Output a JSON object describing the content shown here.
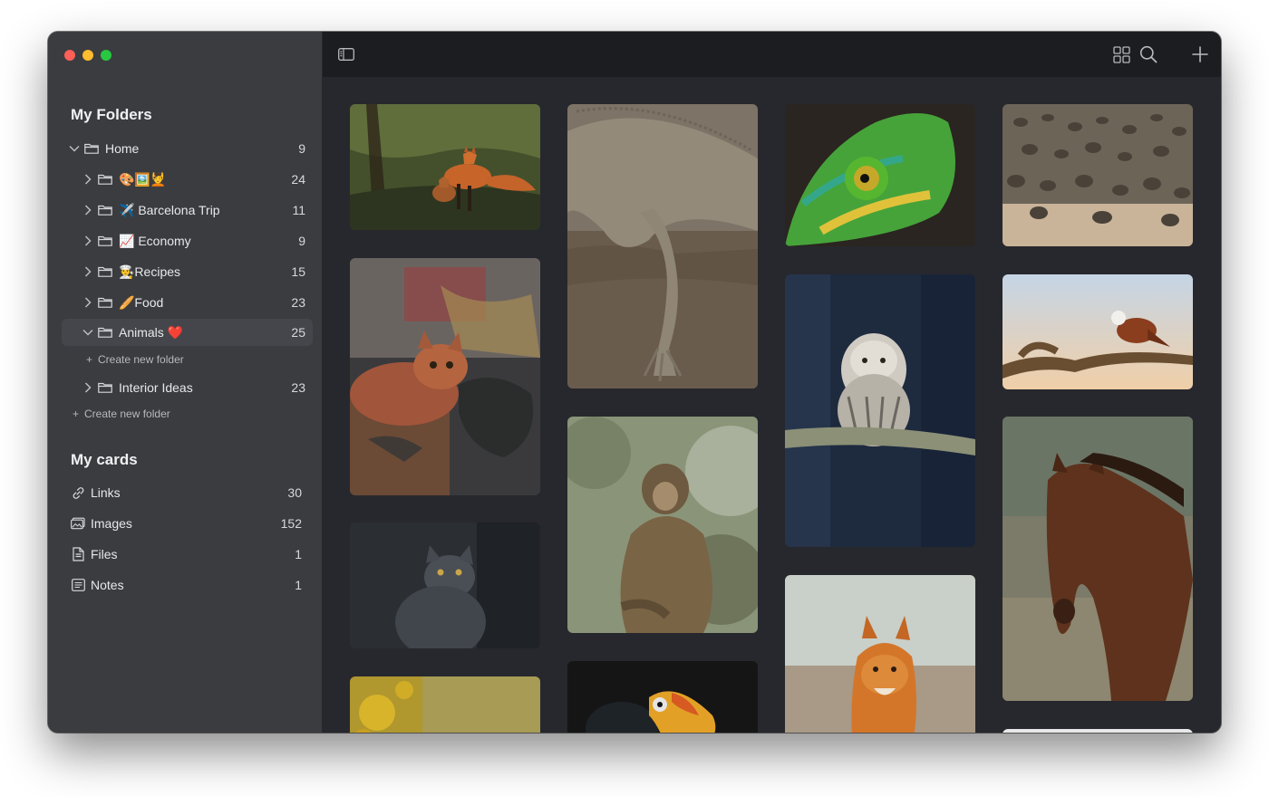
{
  "sidebar": {
    "folders_title": "My Folders",
    "folders": [
      {
        "label": "Home",
        "count": "9",
        "expanded": true
      },
      {
        "label": "🎨🖼️💆",
        "count": "24"
      },
      {
        "label": "✈️ Barcelona Trip",
        "count": "11"
      },
      {
        "label": "📈 Economy",
        "count": "9"
      },
      {
        "label": "👨‍🍳Recipes",
        "count": "15"
      },
      {
        "label": "🥖Food",
        "count": "23"
      },
      {
        "label": "Animals ❤️",
        "count": "25",
        "expanded": true,
        "selected": true
      },
      {
        "label": "Interior Ideas",
        "count": "23"
      }
    ],
    "create_subfolder": "Create new folder",
    "create_folder": "Create new folder",
    "cards_title": "My cards",
    "cards": [
      {
        "label": "Links",
        "count": "30",
        "icon": "link-icon"
      },
      {
        "label": "Images",
        "count": "152",
        "icon": "images-icon"
      },
      {
        "label": "Files",
        "count": "1",
        "icon": "file-icon"
      },
      {
        "label": "Notes",
        "count": "1",
        "icon": "notes-icon"
      }
    ]
  },
  "toolbar": {
    "icons": [
      "sidebar-toggle-icon",
      "grid-view-icon",
      "search-icon",
      "add-icon"
    ]
  },
  "gallery": {
    "images": [
      {
        "subject": "fox-with-cub"
      },
      {
        "subject": "iguana"
      },
      {
        "subject": "chameleon"
      },
      {
        "subject": "seal-colony"
      },
      {
        "subject": "kitten"
      },
      {
        "subject": "barred-owl"
      },
      {
        "subject": "eagle-on-branch"
      },
      {
        "subject": "grey-cat"
      },
      {
        "subject": "macaque"
      },
      {
        "subject": "horse"
      },
      {
        "subject": "fox-portrait"
      },
      {
        "subject": "yellow-flowers"
      },
      {
        "subject": "toucan"
      }
    ]
  },
  "colors": {
    "sidebar_bg": "#3b3c40",
    "content_bg": "#27282d",
    "toolbar_bg": "#1c1d21",
    "selected_row": "#45464b"
  }
}
